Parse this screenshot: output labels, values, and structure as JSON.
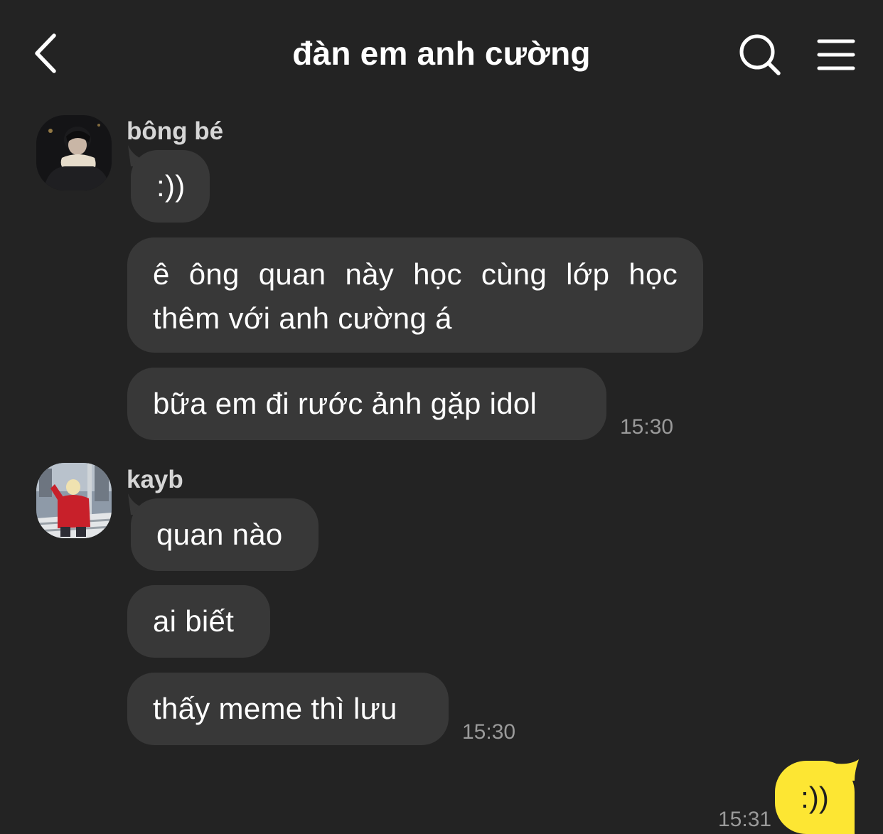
{
  "header": {
    "title": "đàn em anh cường",
    "back_icon": "chevron-left-icon",
    "search_icon": "search-icon",
    "menu_icon": "hamburger-menu-icon"
  },
  "colors": {
    "background": "#232323",
    "incoming_bubble": "#383838",
    "outgoing_bubble": "#fde633",
    "timestamp": "#9a9a9a",
    "sender_name": "#d6d6d6"
  },
  "messages": {
    "group1": {
      "sender": "bông bé",
      "texts": [
        ":))",
        "ê ông quan này học cùng lớp học thêm với anh cường á",
        "bữa em đi rước ảnh gặp idol"
      ],
      "time": "15:30"
    },
    "group2": {
      "sender": "kayb",
      "texts": [
        "quan nào",
        "ai biết",
        "thấy meme thì lưu"
      ],
      "time": "15:30"
    },
    "mine": {
      "text": ":))",
      "time": "15:31"
    }
  }
}
